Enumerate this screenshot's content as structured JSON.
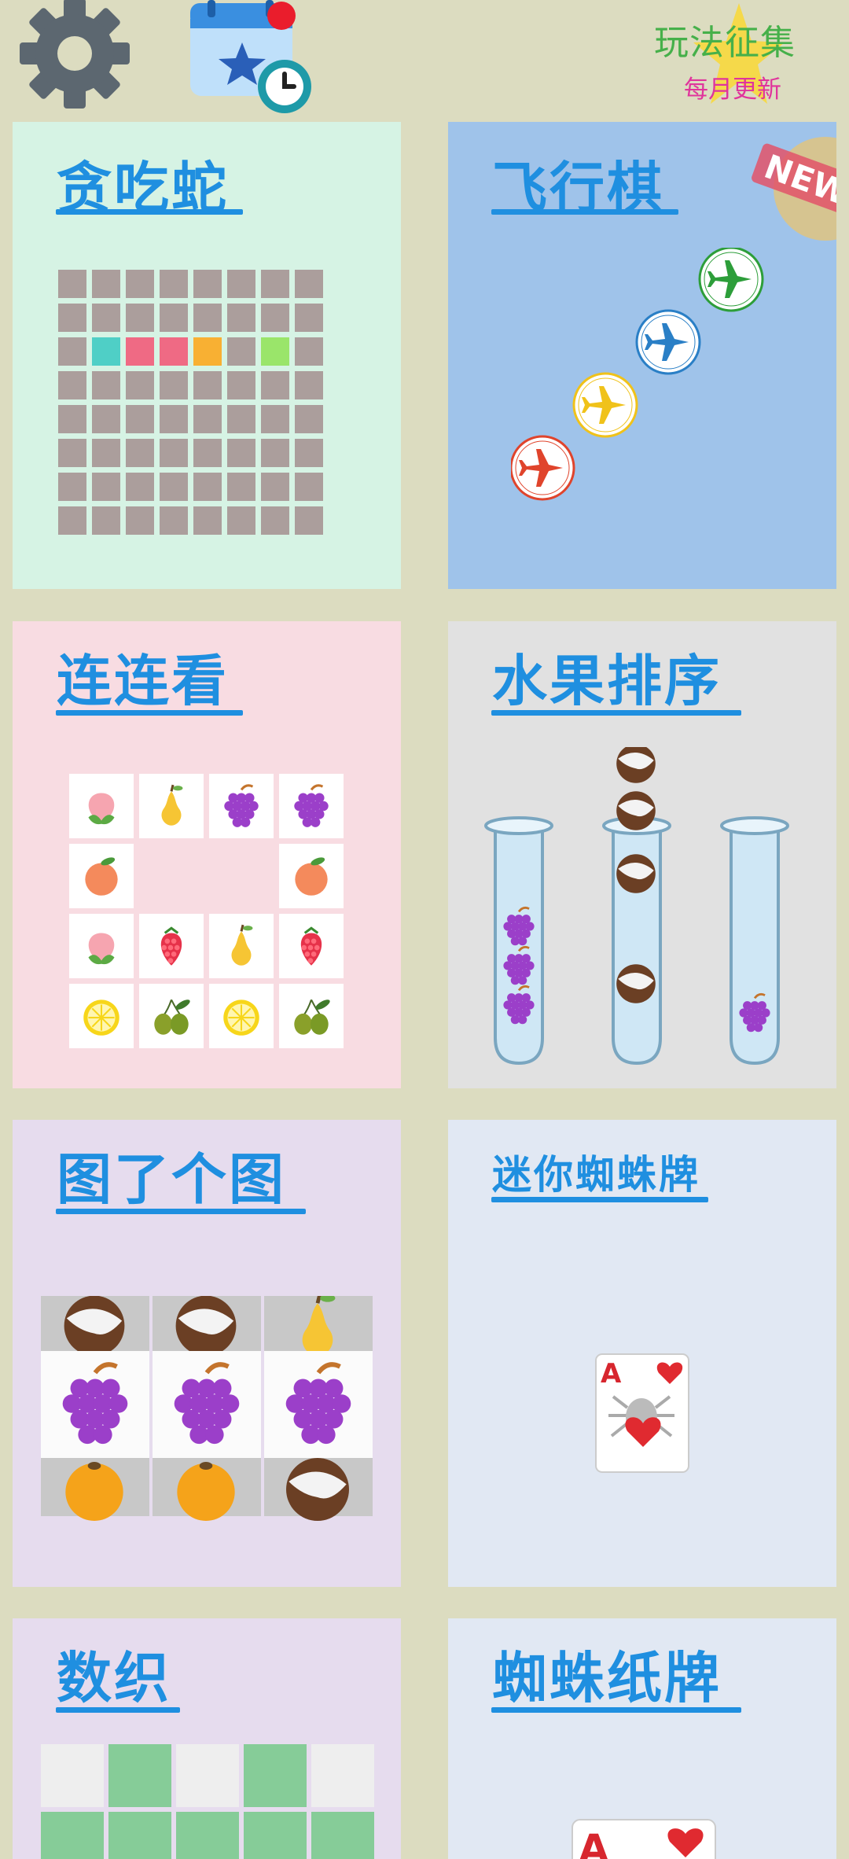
{
  "topbar": {
    "settings_icon": "gear-icon",
    "calendar_icon": "calendar-star-clock-icon",
    "promo": {
      "title": "玩法征集",
      "subtitle": "每月更新"
    }
  },
  "cards": {
    "snake": {
      "title": "贪吃蛇",
      "bg": "#d6f3e4"
    },
    "ludo": {
      "title": "飞行棋",
      "badge": "NEW",
      "bg": "#9fc3ea"
    },
    "match": {
      "title": "连连看",
      "bg": "#f8dce2"
    },
    "fruit_sort": {
      "title": "水果排序",
      "bg": "#e1e1e1"
    },
    "tile_match": {
      "title": "图了个图",
      "bg": "#e6dcee"
    },
    "mini_spider": {
      "title": "迷你蜘蛛牌",
      "bg": "#e1e8f3",
      "card_rank": "A"
    },
    "nonogram": {
      "title": "数织",
      "bg": "#e6dcee"
    },
    "spider_solitaire": {
      "title": "蜘蛛纸牌",
      "bg": "#e1e8f3",
      "card_rank": "A"
    }
  },
  "colors": {
    "accent": "#1f8fe0",
    "snake_cells": [
      "#4fcfc6",
      "#ef6a84",
      "#ef6a84",
      "#f8b033",
      "#9ae56a"
    ],
    "planes": [
      "#2d9e3a",
      "#2a7fc6",
      "#f0c21a",
      "#e0442c"
    ]
  },
  "icons": {
    "match_grid": [
      [
        "peach",
        "pear",
        "grape",
        "grape"
      ],
      [
        "apricot",
        "",
        "",
        "apricot"
      ],
      [
        "peach",
        "raspberry",
        "pear",
        "raspberry"
      ],
      [
        "lemon",
        "olive",
        "lemon",
        "olive"
      ]
    ],
    "tile_stack": [
      "coconut",
      "grape",
      "orange"
    ],
    "tubes": [
      [
        "grape",
        "grape",
        "grape"
      ],
      [
        "coconut",
        "coconut",
        "coconut",
        "coconut"
      ],
      [
        "grape"
      ]
    ]
  }
}
